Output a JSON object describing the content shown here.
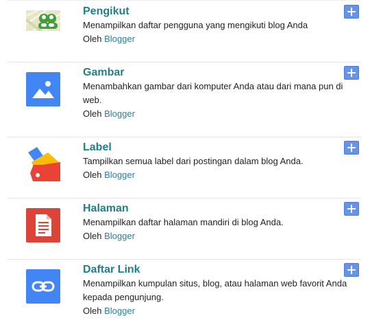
{
  "byline_prefix": "Oleh",
  "byline_author": "Blogger",
  "gadgets": [
    {
      "title": "Pengikut",
      "description": "Menampilkan daftar pengguna yang mengikuti blog Anda",
      "icon": "followers-icon"
    },
    {
      "title": "Gambar",
      "description": "Menambahkan gambar dari komputer Anda atau dari mana pun di web.",
      "icon": "image-icon"
    },
    {
      "title": "Label",
      "description": "Tampilkan semua label dari postingan dalam blog Anda.",
      "icon": "label-icon"
    },
    {
      "title": "Halaman",
      "description": "Menampilkan daftar halaman mandiri di blog Anda.",
      "icon": "page-icon"
    },
    {
      "title": "Daftar Link",
      "description": "Menampilkan kumpulan situs, blog, atau halaman web favorit Anda kepada pengunjung.",
      "icon": "link-icon"
    }
  ],
  "colors": {
    "title": "#227e8a",
    "link": "#2a7f98",
    "add_button": "#6594ea"
  }
}
